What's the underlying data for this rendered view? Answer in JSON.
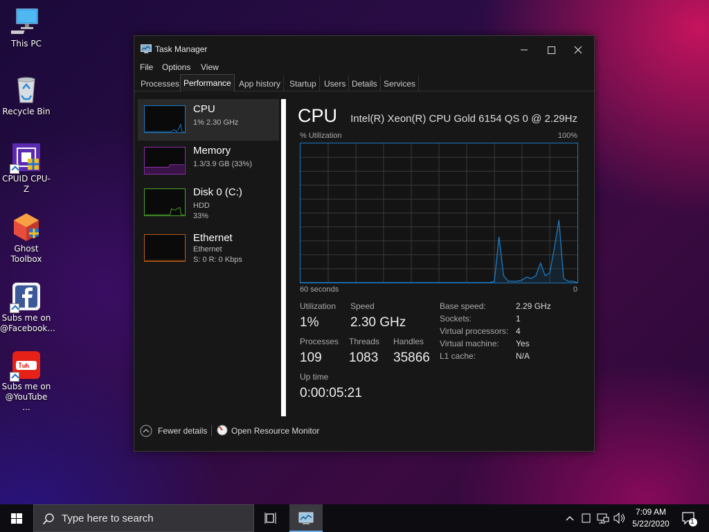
{
  "desktop": {
    "icons": [
      {
        "label_line1": "This PC",
        "label_line2": ""
      },
      {
        "label_line1": "Recycle Bin",
        "label_line2": ""
      },
      {
        "label_line1": "CPUID CPU-Z",
        "label_line2": ""
      },
      {
        "label_line1": "Ghost",
        "label_line2": "Toolbox"
      },
      {
        "label_line1": "Subs me on",
        "label_line2": "@Facebook..."
      },
      {
        "label_line1": "Subs me on",
        "label_line2": "@YouTube ..."
      }
    ]
  },
  "window": {
    "title": "Task Manager",
    "menu": [
      "File",
      "Options",
      "View"
    ],
    "tabs": [
      "Processes",
      "Performance",
      "App history",
      "Startup",
      "Users",
      "Details",
      "Services"
    ],
    "active_tab": "Performance"
  },
  "sidebar": {
    "items": [
      {
        "name": "CPU",
        "line1": "1% 2.30 GHz",
        "line2": "",
        "color": "#1e7bc4"
      },
      {
        "name": "Memory",
        "line1": "1.3/3.9 GB (33%)",
        "line2": "",
        "color": "#8b2fa8"
      },
      {
        "name": "Disk 0 (C:)",
        "line1": "HDD",
        "line2": "33%",
        "color": "#4ca22c"
      },
      {
        "name": "Ethernet",
        "line1": "Ethernet",
        "line2": "S: 0 R: 0 Kbps",
        "color": "#b85e17"
      }
    ]
  },
  "cpu": {
    "title": "CPU",
    "model": "Intel(R) Xeon(R) CPU Gold 6154 QS 0 @ 2.29Hz",
    "graph": {
      "ylabel": "% Utilization",
      "ymax_label": "100%",
      "xlabel_left": "60 seconds",
      "xlabel_right": "0",
      "line_color": "#1e7bc4"
    },
    "stats": {
      "utilization_label": "Utilization",
      "utilization": "1%",
      "speed_label": "Speed",
      "speed": "2.30 GHz",
      "processes_label": "Processes",
      "processes": "109",
      "threads_label": "Threads",
      "threads": "1083",
      "handles_label": "Handles",
      "handles": "35866",
      "uptime_label": "Up time",
      "uptime": "0:00:05:21"
    },
    "details": [
      {
        "key": "Base speed:",
        "value": "2.29 GHz"
      },
      {
        "key": "Sockets:",
        "value": "1"
      },
      {
        "key": "Virtual processors:",
        "value": "4"
      },
      {
        "key": "Virtual machine:",
        "value": "Yes"
      },
      {
        "key": "L1 cache:",
        "value": "N/A"
      }
    ]
  },
  "chart_data": {
    "type": "line",
    "x": [
      60,
      57,
      54,
      51,
      48,
      45,
      42,
      39,
      36,
      33,
      30,
      27,
      24,
      21,
      20,
      19,
      18,
      17,
      16,
      15,
      14,
      13,
      12,
      11,
      10,
      9,
      8,
      7,
      6,
      5,
      4,
      3,
      2,
      1,
      0
    ],
    "values": [
      0,
      0,
      0,
      0,
      0,
      0,
      0,
      0,
      0,
      0,
      0,
      0,
      0,
      0,
      0,
      0,
      1,
      33,
      5,
      1,
      1,
      1,
      2,
      4,
      3,
      5,
      14,
      5,
      7,
      25,
      45,
      3,
      1,
      1,
      0
    ],
    "xlabel": "60 seconds",
    "ylabel": "% Utilization",
    "xlim": [
      60,
      0
    ],
    "ylim": [
      0,
      100
    ],
    "grid": true
  },
  "footer": {
    "fewer_details": "Fewer details",
    "resource_monitor": "Open Resource Monitor"
  },
  "taskbar": {
    "search_placeholder": "Type here to search",
    "time": "7:09 AM",
    "date": "5/22/2020",
    "notification_count": "1"
  }
}
